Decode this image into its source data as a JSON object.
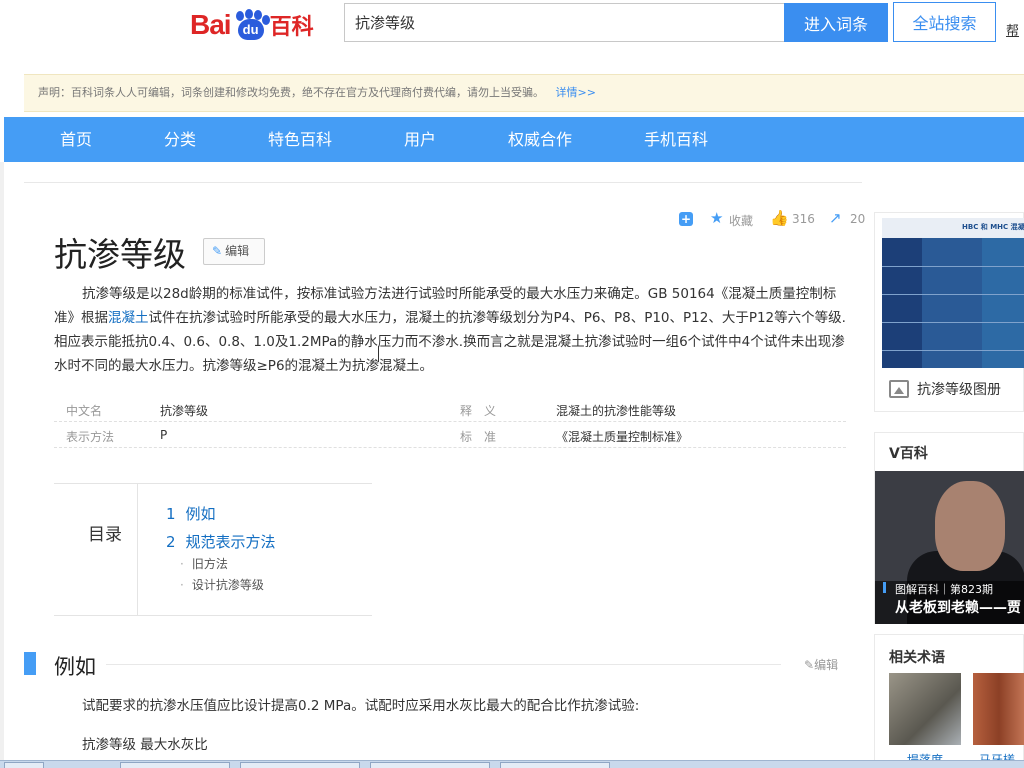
{
  "header": {
    "logo_bai": "Bai",
    "logo_du": "du",
    "logo_cn": "百科",
    "search_value": "抗渗等级",
    "enter_button": "进入词条",
    "site_search_button": "全站搜索",
    "help": "帮"
  },
  "notice": {
    "text": "声明：百科词条人人可编辑，词条创建和修改均免费，绝不存在官方及代理商付费代编，请勿上当受骗。",
    "more": "详情>>"
  },
  "nav": {
    "items": [
      "首页",
      "分类",
      "特色百科",
      "用户",
      "权威合作",
      "手机百科"
    ]
  },
  "toolbar": {
    "plus": "+",
    "favorite": "收藏",
    "likes": "316",
    "shares": "20"
  },
  "article": {
    "title": "抗渗等级",
    "edit": "编辑",
    "summary_part1": "抗渗等级是以28d龄期的标准试件，按标准试验方法进行试验时所能承受的最大水压力来确定。GB 50164《混凝土质量控制标准》根据",
    "summary_link": "混凝土",
    "summary_part2": "试件在抗渗试验时所能承受的最大水压力，混凝土的抗渗等级划分为P4、P6、P8、P10、P12、大于P12等六个等级.相应表示能抵抗0.4、0.6、0.8、1.0及1.2MPa的静水压力而不渗水.换而言之就是混凝土抗渗试验时一组6个试件中4个试件未出现渗水时不同的最大水压力。抗渗等级≥P6的混凝土为抗渗混凝土。"
  },
  "basic_info": [
    {
      "k1": "中文名",
      "v1": "抗渗等级",
      "k2": "释　义",
      "v2": "混凝土的抗渗性能等级"
    },
    {
      "k1": "表示方法",
      "v1": "P",
      "k2": "标　准",
      "v2": "《混凝土质量控制标准》"
    }
  ],
  "toc": {
    "label": "目录",
    "l1": [
      {
        "n": "1",
        "t": "例如"
      },
      {
        "n": "2",
        "t": "规范表示方法"
      }
    ],
    "l2": [
      "旧方法",
      "设计抗渗等级"
    ],
    "dot": "·"
  },
  "section": {
    "title": "例如",
    "edit": "编辑",
    "para1": "试配要求的抗渗水压值应比设计提高0.2 MPa。试配时应采用水灰比最大的配合比作抗渗试验:",
    "para2": "抗渗等级 最大水灰比"
  },
  "sidebar": {
    "album_caption": "抗渗等级图册",
    "album_header": "HBC 和 MHC 混凝",
    "vbaike_title": "V百科",
    "vbaike_issue": "图解百科｜第823期",
    "vbaike_headline": "从老板到老赖——贾",
    "terms_title": "相关术语",
    "term1": "堤落度",
    "term2": "马牙槎"
  },
  "colors": {
    "accent": "#459df5",
    "link": "#136ec2",
    "brand_red": "#de2626",
    "notice_bg": "#fcf7e3"
  }
}
